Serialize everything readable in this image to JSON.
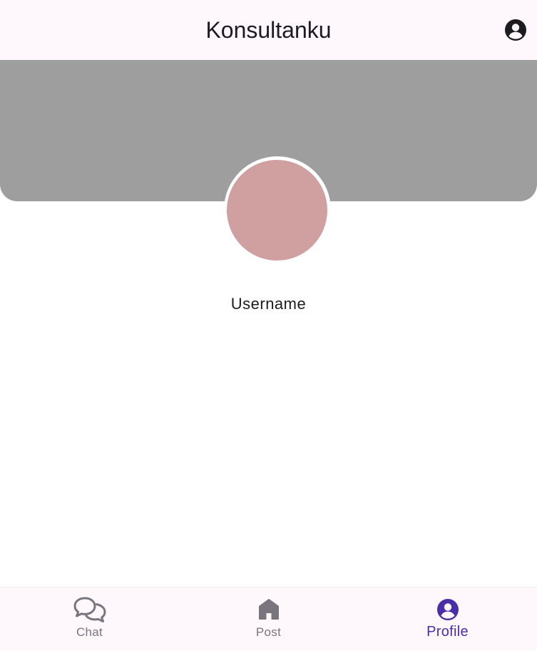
{
  "app_bar": {
    "title": "Konsultanku",
    "account_icon": "account-circle-icon"
  },
  "profile": {
    "username": "Username",
    "banner_color": "#9e9e9e",
    "avatar_color": "#d09fa0"
  },
  "bottom_nav": {
    "active": "Profile",
    "active_color": "#4a2ea8",
    "inactive_color": "#79747e",
    "items": [
      {
        "label": "Chat",
        "icon": "chat-bubbles-icon"
      },
      {
        "label": "Post",
        "icon": "home-icon"
      },
      {
        "label": "Profile",
        "icon": "account-circle-icon"
      }
    ]
  }
}
